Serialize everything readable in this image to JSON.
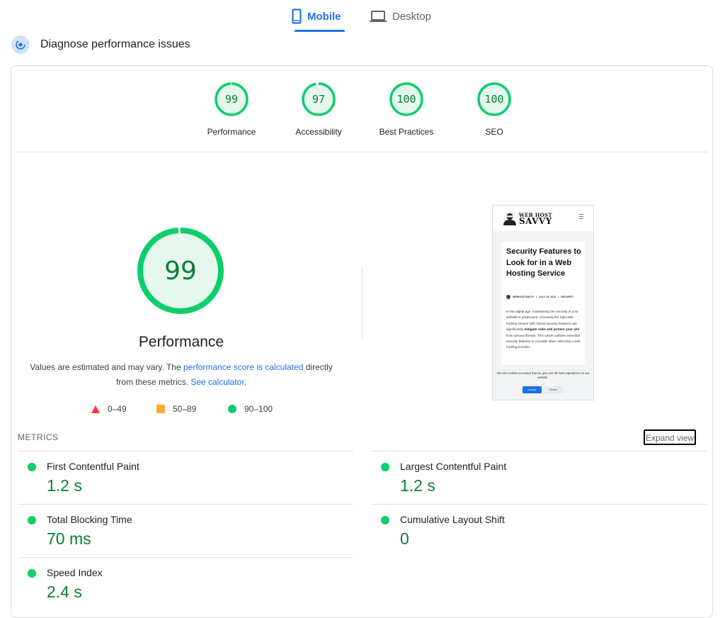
{
  "tabs": {
    "mobile": "Mobile",
    "desktop": "Desktop"
  },
  "header": {
    "title": "Diagnose performance issues"
  },
  "categories": [
    {
      "score": "99",
      "label": "Performance",
      "value": 99
    },
    {
      "score": "97",
      "label": "Accessibility",
      "value": 97
    },
    {
      "score": "100",
      "label": "Best Practices",
      "value": 100
    },
    {
      "score": "100",
      "label": "SEO",
      "value": 100
    }
  ],
  "performance": {
    "score": "99",
    "value": 99,
    "title": "Performance",
    "desc_part1": "Values are estimated and may vary. The ",
    "desc_link1": "performance score is calculated",
    "desc_part2": " directly from these metrics. ",
    "desc_link2": "See calculator."
  },
  "legend": [
    {
      "range": "0–49",
      "color": "#ff3333"
    },
    {
      "range": "50–89",
      "color": "#ffaa33"
    },
    {
      "range": "90–100",
      "color": "#0cce6b"
    }
  ],
  "thumbnail": {
    "logo_top": "WEB HOST",
    "logo_bottom": "SAVVY",
    "article_title": "Security Features to Look for in a Web Hosting Service",
    "meta_author": "WEBHOSTSAVVY",
    "meta_date": "JULY 15, 2024",
    "meta_category": "SECURITY",
    "body_1": "In the digital age, maintaining the security of your website is paramount. Choosing the right web hosting service with robust security features can significantly ",
    "body_bold": "mitigate risks and protect your site",
    "body_2": " from various threats. This article outlines essential security features to consider when selecting a web hosting provider.",
    "cookie_text": "We use cookies to ensure that we give you the best experience on our website.",
    "accept": "Accept",
    "decline": "Decline"
  },
  "metrics": {
    "title": "METRICS",
    "expand": "Expand view",
    "items": [
      {
        "label": "First Contentful Paint",
        "value": "1.2 s"
      },
      {
        "label": "Largest Contentful Paint",
        "value": "1.2 s"
      },
      {
        "label": "Total Blocking Time",
        "value": "70 ms"
      },
      {
        "label": "Cumulative Layout Shift",
        "value": "0"
      },
      {
        "label": "Speed Index",
        "value": "2.4 s"
      }
    ]
  },
  "colors": {
    "pass": "#0cce6b",
    "pass_text": "#0c7d36",
    "pass_fill": "#e6f8ee",
    "accent": "#1a73e8"
  }
}
